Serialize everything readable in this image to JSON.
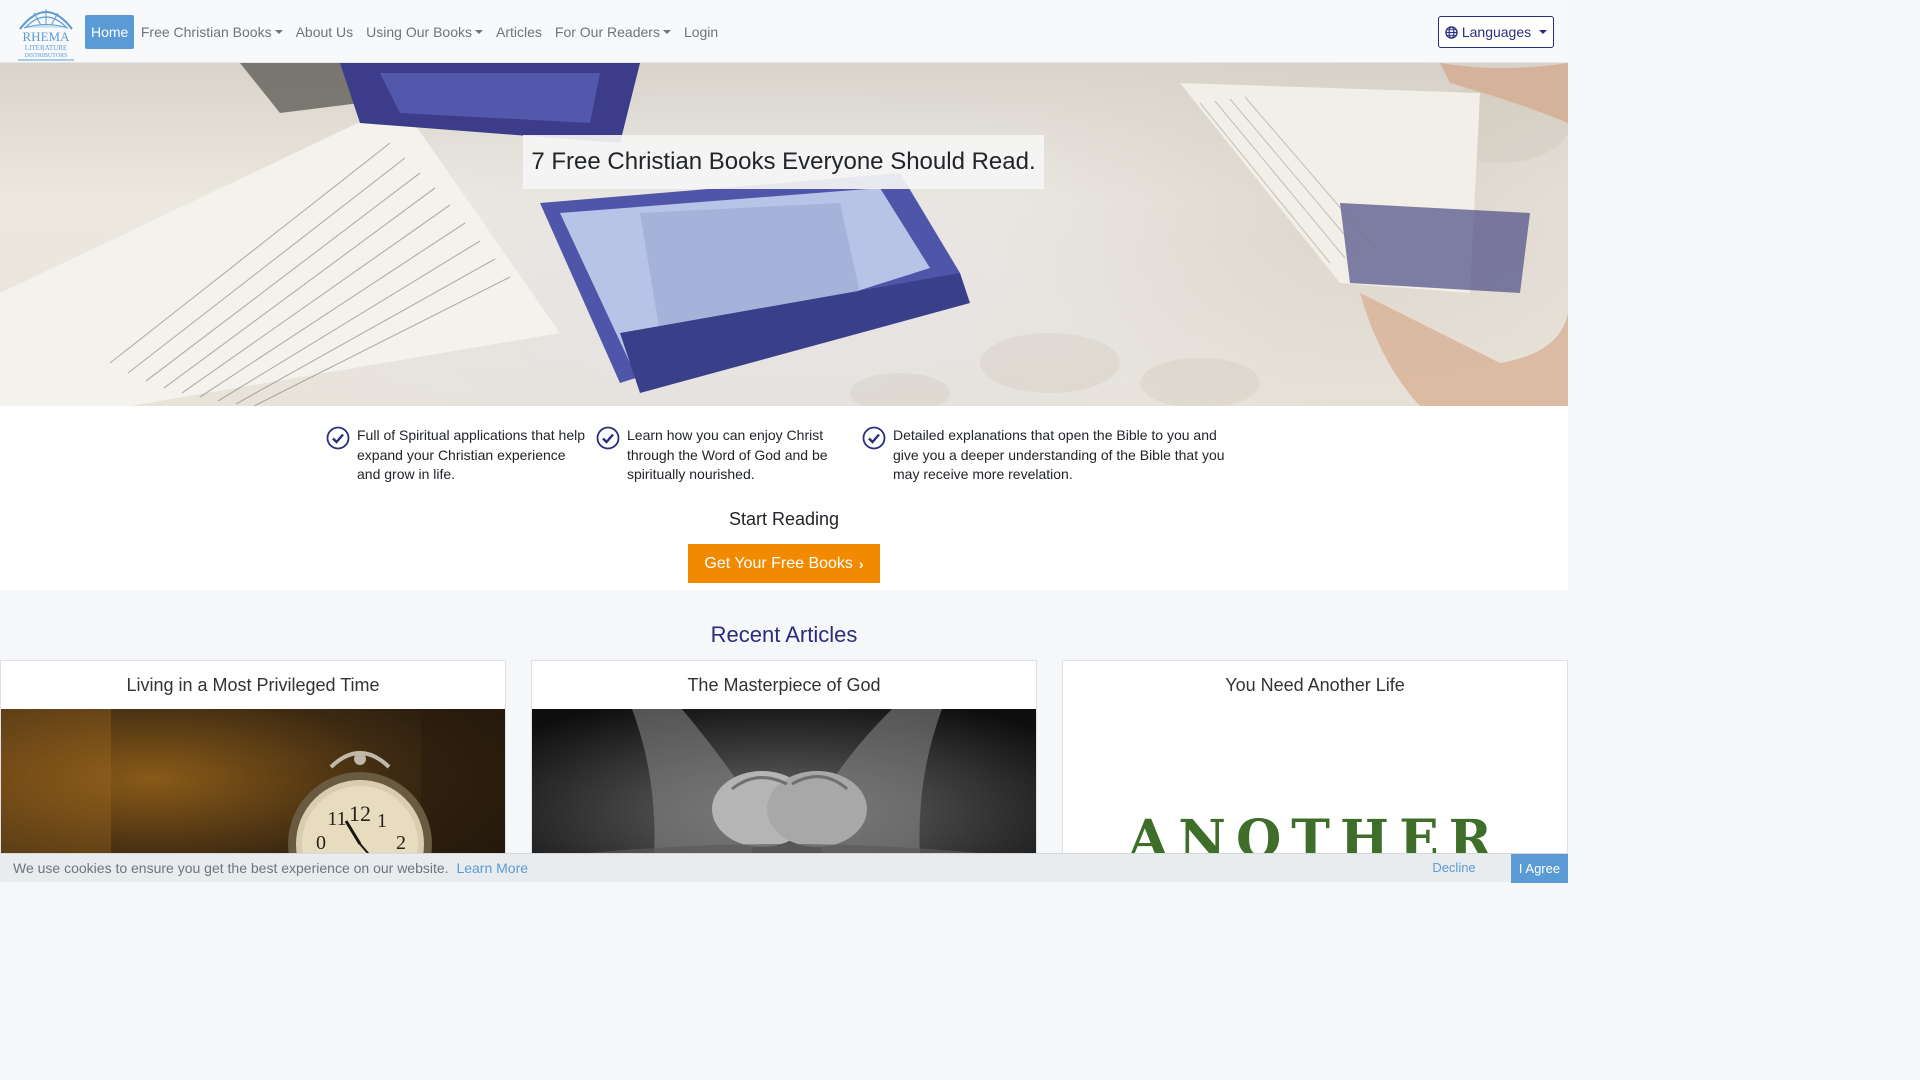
{
  "brand": {
    "logo_text_1": "RHEMA",
    "logo_text_2": "LITERATURE",
    "logo_text_3": "DISTRIBUTORS"
  },
  "nav": {
    "items": [
      {
        "label": "Home",
        "active": true,
        "dropdown": false
      },
      {
        "label": "Free Christian Books",
        "active": false,
        "dropdown": true
      },
      {
        "label": "About Us",
        "active": false,
        "dropdown": false
      },
      {
        "label": "Using Our Books",
        "active": false,
        "dropdown": true
      },
      {
        "label": "Articles",
        "active": false,
        "dropdown": false
      },
      {
        "label": "For Our Readers",
        "active": false,
        "dropdown": true
      },
      {
        "label": "Login",
        "active": false,
        "dropdown": false
      }
    ],
    "languages_label": "Languages"
  },
  "hero": {
    "title": "7 Free Christian Books Everyone Should Read."
  },
  "features": [
    {
      "text": "Full of Spiritual applications that help expand your Christian experience and grow in life."
    },
    {
      "text": "Learn how you can enjoy Christ through the Word of God and be spiritually nourished."
    },
    {
      "text": "Detailed explanations that open the Bible to you and give you a deeper understanding of the Bible that you may receive more revelation."
    }
  ],
  "start_reading": {
    "label": "Start Reading",
    "button_label": "Get Your Free Books"
  },
  "articles": {
    "heading": "Recent Articles",
    "cards": [
      {
        "title": "Living in a Most Privileged Time"
      },
      {
        "title": "The Masterpiece of God"
      },
      {
        "title": "You Need Another Life",
        "image_word": "ANOTHER"
      }
    ]
  },
  "cookie": {
    "message": "We use cookies to ensure you get the best experience on our website.",
    "learn_more": "Learn More",
    "decline": "Decline",
    "agree": "I Agree"
  },
  "colors": {
    "primary": "#2a2d7c",
    "accent": "#f28a00",
    "active_nav": "#5b9bd5"
  }
}
